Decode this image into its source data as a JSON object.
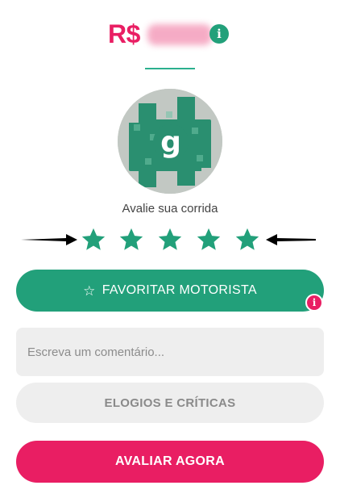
{
  "fare": {
    "currency_label": "R$",
    "value_obscured": true,
    "info_icon": "info-icon",
    "info_glyph": "i"
  },
  "driver": {
    "avatar_icon": "driver-avatar"
  },
  "rating": {
    "prompt": "Avalie sua corrida",
    "max_stars": 5,
    "selected": 5,
    "star_color": "#22a07a"
  },
  "actions": {
    "favorite_label": "FAVORITAR MOTORISTA",
    "favorite_icon": "star-outline-icon",
    "favorite_glyph": "☆",
    "favorite_info_glyph": "i",
    "comment_placeholder": "Escreva um comentário...",
    "praise_label": "ELOGIOS E CRÍTICAS",
    "submit_label": "AVALIAR AGORA"
  },
  "colors": {
    "brand_pink": "#e91e63",
    "brand_green": "#22a07a",
    "field_gray": "#eeeeee"
  }
}
